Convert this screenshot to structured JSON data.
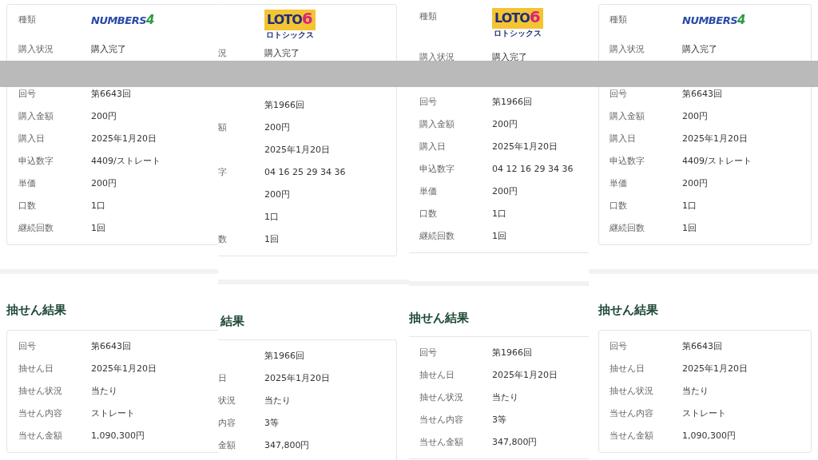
{
  "panels": [
    {
      "purchase": {
        "rows": [
          {
            "kind": "numbers_logo",
            "label": "種類",
            "logo": {
              "name": "NUMBERS",
              "digit": "4"
            }
          },
          {
            "kind": "text",
            "label": "購入状況",
            "value": "購入完了"
          },
          {
            "kind": "text",
            "label": "回号",
            "value": "第6643回"
          },
          {
            "kind": "text",
            "label": "購入金額",
            "value": "200円"
          },
          {
            "kind": "text",
            "label": "購入日",
            "value": "2025年1月20日"
          },
          {
            "kind": "text",
            "label": "申込数字",
            "value": "4409/ストレート"
          },
          {
            "kind": "text",
            "label": "単価",
            "value": "200円"
          },
          {
            "kind": "text",
            "label": "口数",
            "value": "1口"
          },
          {
            "kind": "text",
            "label": "継続回数",
            "value": "1回"
          }
        ]
      },
      "result": {
        "heading": "抽せん結果",
        "rows": [
          {
            "label": "回号",
            "value": "第6643回"
          },
          {
            "label": "抽せん日",
            "value": "2025年1月20日"
          },
          {
            "label": "抽せん状況",
            "value": "当たり"
          },
          {
            "label": "当せん内容",
            "value": "ストレート"
          },
          {
            "label": "当せん金額",
            "value": "1,090,300円"
          }
        ]
      }
    },
    {
      "purchase": {
        "rows": [
          {
            "kind": "loto_logo",
            "logo": {
              "name": "LOTO",
              "digit": "6",
              "sub": "ロトシックス"
            }
          },
          {
            "kind": "text",
            "label": "況",
            "value": "購入完了"
          },
          {
            "kind": "text",
            "value": "第1966回"
          },
          {
            "kind": "text",
            "label": "額",
            "value": "200円"
          },
          {
            "kind": "text",
            "value": "2025年1月20日"
          },
          {
            "kind": "text",
            "label": "字",
            "value": "04 16 25 29 34 36"
          },
          {
            "kind": "text",
            "value": "200円"
          },
          {
            "kind": "text",
            "value": "1口"
          },
          {
            "kind": "text",
            "label": "数",
            "value": "1回"
          }
        ]
      },
      "result": {
        "heading": "結果",
        "rows": [
          {
            "value": "第1966回"
          },
          {
            "label": "日",
            "value": "2025年1月20日"
          },
          {
            "label": "状況",
            "value": "当たり"
          },
          {
            "label": "内容",
            "value": "3等"
          },
          {
            "label": "金額",
            "value": "347,800円"
          }
        ]
      }
    },
    {
      "purchase": {
        "rows": [
          {
            "kind": "loto_logo",
            "label": "種類",
            "logo": {
              "name": "LOTO",
              "digit": "6",
              "sub": "ロトシックス"
            }
          },
          {
            "kind": "text",
            "label": "購入状況",
            "value": "購入完了"
          },
          {
            "kind": "text",
            "label": "回号",
            "value": "第1966回"
          },
          {
            "kind": "text",
            "label": "購入金額",
            "value": "200円"
          },
          {
            "kind": "text",
            "label": "購入日",
            "value": "2025年1月20日"
          },
          {
            "kind": "text",
            "label": "申込数字",
            "value": "04 12 16 29 34 36"
          },
          {
            "kind": "text",
            "label": "単価",
            "value": "200円"
          },
          {
            "kind": "text",
            "label": "口数",
            "value": "1口"
          },
          {
            "kind": "text",
            "label": "継続回数",
            "value": "1回"
          }
        ]
      },
      "result": {
        "heading": "抽せん結果",
        "rows": [
          {
            "label": "回号",
            "value": "第1966回"
          },
          {
            "label": "抽せん日",
            "value": "2025年1月20日"
          },
          {
            "label": "抽せん状況",
            "value": "当たり"
          },
          {
            "label": "当せん内容",
            "value": "3等"
          },
          {
            "label": "当せん金額",
            "value": "347,800円"
          }
        ]
      }
    },
    {
      "purchase": {
        "rows": [
          {
            "kind": "numbers_logo",
            "label": "種類",
            "logo": {
              "name": "NUMBERS",
              "digit": "4"
            }
          },
          {
            "kind": "text",
            "label": "購入状況",
            "value": "購入完了"
          },
          {
            "kind": "text",
            "label": "回号",
            "value": "第6643回"
          },
          {
            "kind": "text",
            "label": "購入金額",
            "value": "200円"
          },
          {
            "kind": "text",
            "label": "購入日",
            "value": "2025年1月20日"
          },
          {
            "kind": "text",
            "label": "申込数字",
            "value": "4409/ストレート"
          },
          {
            "kind": "text",
            "label": "単価",
            "value": "200円"
          },
          {
            "kind": "text",
            "label": "口数",
            "value": "1口"
          },
          {
            "kind": "text",
            "label": "継続回数",
            "value": "1回"
          }
        ]
      },
      "result": {
        "heading": "抽せん結果",
        "rows": [
          {
            "label": "回号",
            "value": "第6643回"
          },
          {
            "label": "抽せん日",
            "value": "2025年1月20日"
          },
          {
            "label": "抽せん状況",
            "value": "当たり"
          },
          {
            "label": "当せん内容",
            "value": "ストレート"
          },
          {
            "label": "当せん金額",
            "value": "1,090,300円"
          }
        ]
      }
    }
  ]
}
